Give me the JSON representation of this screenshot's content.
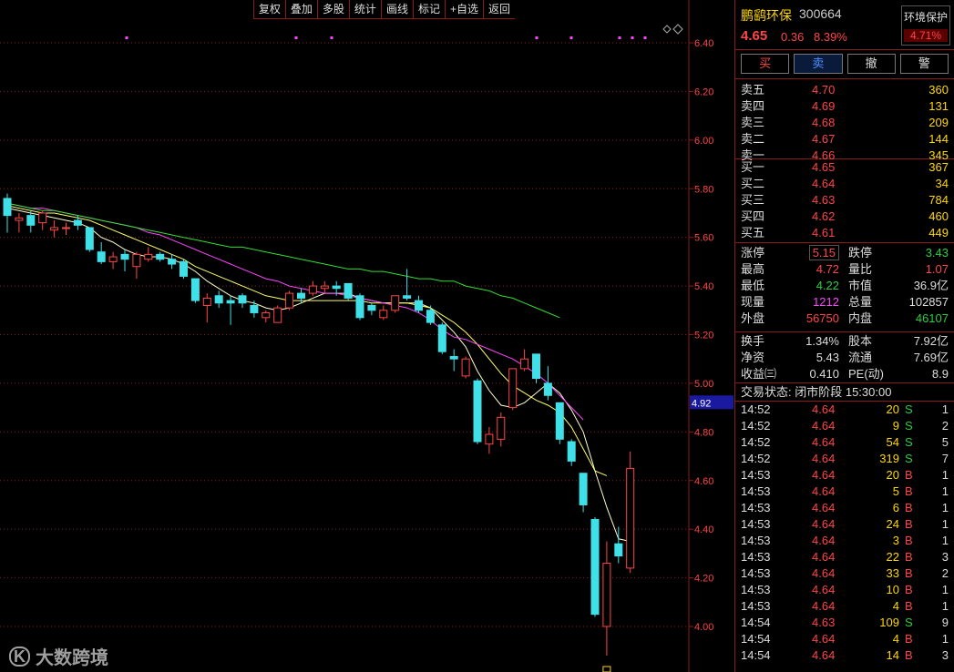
{
  "toolbar": {
    "items": [
      "复权",
      "叠加",
      "多股",
      "统计",
      "画线",
      "标记",
      "+自选",
      "返回"
    ]
  },
  "header": {
    "name": "鹏鹞环保",
    "code": "300664",
    "price": "4.65",
    "change": "0.36",
    "change_pct": "8.39%",
    "sector_name": "环境保护",
    "sector_pct": "4.71%"
  },
  "trade_buttons": {
    "buy": "买",
    "sell": "卖",
    "cancel": "撤",
    "alert": "警"
  },
  "asks": [
    {
      "label": "卖五",
      "price": "4.70",
      "vol": "360"
    },
    {
      "label": "卖四",
      "price": "4.69",
      "vol": "131"
    },
    {
      "label": "卖三",
      "price": "4.68",
      "vol": "209"
    },
    {
      "label": "卖二",
      "price": "4.67",
      "vol": "144"
    },
    {
      "label": "卖一",
      "price": "4.66",
      "vol": "345"
    }
  ],
  "bids": [
    {
      "label": "买一",
      "price": "4.65",
      "vol": "367"
    },
    {
      "label": "买二",
      "price": "4.64",
      "vol": "34"
    },
    {
      "label": "买三",
      "price": "4.63",
      "vol": "784"
    },
    {
      "label": "买四",
      "price": "4.62",
      "vol": "460"
    },
    {
      "label": "买五",
      "price": "4.61",
      "vol": "449"
    }
  ],
  "stats": {
    "limit_up_label": "涨停",
    "limit_up": "5.15",
    "limit_down_label": "跌停",
    "limit_down": "3.43",
    "high_label": "最高",
    "high": "4.72",
    "vol_ratio_label": "量比",
    "vol_ratio": "1.07",
    "low_label": "最低",
    "low": "4.22",
    "mcap_label": "市值",
    "mcap": "36.9亿",
    "last_vol_label": "现量",
    "last_vol": "1212",
    "total_vol_label": "总量",
    "total_vol": "102857",
    "outer_label": "外盘",
    "outer": "56750",
    "inner_label": "内盘",
    "inner": "46107"
  },
  "stats2": {
    "turnover_label": "换手",
    "turnover": "1.34%",
    "shares_label": "股本",
    "shares": "7.92亿",
    "nav_label": "净资",
    "nav": "5.43",
    "float_label": "流通",
    "float": "7.69亿",
    "eps_label": "收益㈢",
    "eps": "0.410",
    "pe_label": "PE(动)",
    "pe": "8.9"
  },
  "status": "交易状态: 闭市阶段 15:30:00",
  "ticks": [
    {
      "time": "14:52",
      "price": "4.64",
      "vol": "20",
      "side": "S",
      "cnt": "1"
    },
    {
      "time": "14:52",
      "price": "4.64",
      "vol": "9",
      "side": "S",
      "cnt": "2"
    },
    {
      "time": "14:52",
      "price": "4.64",
      "vol": "54",
      "side": "S",
      "cnt": "5"
    },
    {
      "time": "14:52",
      "price": "4.64",
      "vol": "319",
      "side": "S",
      "cnt": "7"
    },
    {
      "time": "14:53",
      "price": "4.64",
      "vol": "20",
      "side": "B",
      "cnt": "1"
    },
    {
      "time": "14:53",
      "price": "4.64",
      "vol": "5",
      "side": "B",
      "cnt": "1"
    },
    {
      "time": "14:53",
      "price": "4.64",
      "vol": "6",
      "side": "B",
      "cnt": "1"
    },
    {
      "time": "14:53",
      "price": "4.64",
      "vol": "24",
      "side": "B",
      "cnt": "1"
    },
    {
      "time": "14:53",
      "price": "4.64",
      "vol": "3",
      "side": "B",
      "cnt": "1"
    },
    {
      "time": "14:53",
      "price": "4.64",
      "vol": "22",
      "side": "B",
      "cnt": "3"
    },
    {
      "time": "14:53",
      "price": "4.64",
      "vol": "33",
      "side": "B",
      "cnt": "2"
    },
    {
      "time": "14:53",
      "price": "4.64",
      "vol": "10",
      "side": "B",
      "cnt": "1"
    },
    {
      "time": "14:53",
      "price": "4.64",
      "vol": "4",
      "side": "B",
      "cnt": "1"
    },
    {
      "time": "14:54",
      "price": "4.63",
      "vol": "109",
      "side": "S",
      "cnt": "9"
    },
    {
      "time": "14:54",
      "price": "4.64",
      "vol": "4",
      "side": "B",
      "cnt": "1"
    },
    {
      "time": "14:54",
      "price": "4.64",
      "vol": "14",
      "side": "B",
      "cnt": "3"
    }
  ],
  "watermark": "大数跨境",
  "watermark_logo": "K",
  "colors": {
    "up": "#ff4545",
    "down": "#3fe0e8",
    "ma5": "#ffffcc",
    "ma10": "#ffff66",
    "ma20": "#ff44ff",
    "ma60": "#33dd33",
    "grid": "#8b1a1a",
    "current_price_bg": "#1a1aa0"
  },
  "chart_data": {
    "type": "candlestick",
    "y_ticks": [
      "6.40",
      "6.20",
      "6.00",
      "5.80",
      "5.60",
      "5.40",
      "5.20",
      "5.00",
      "4.80",
      "4.60",
      "4.40",
      "4.20",
      "4.00"
    ],
    "ylim": [
      3.9,
      6.45
    ],
    "current_price_label": "4.92",
    "low_marker_label": "3.88",
    "candles": [
      {
        "o": 5.76,
        "c": 5.69,
        "h": 5.78,
        "l": 5.62
      },
      {
        "o": 5.67,
        "c": 5.68,
        "h": 5.7,
        "l": 5.62
      },
      {
        "o": 5.69,
        "c": 5.65,
        "h": 5.71,
        "l": 5.62
      },
      {
        "o": 5.66,
        "c": 5.7,
        "h": 5.71,
        "l": 5.63
      },
      {
        "o": 5.63,
        "c": 5.64,
        "h": 5.67,
        "l": 5.6
      },
      {
        "o": 5.64,
        "c": 5.64,
        "h": 5.66,
        "l": 5.61
      },
      {
        "o": 5.67,
        "c": 5.65,
        "h": 5.69,
        "l": 5.63
      },
      {
        "o": 5.64,
        "c": 5.55,
        "h": 5.64,
        "l": 5.54
      },
      {
        "o": 5.54,
        "c": 5.5,
        "h": 5.58,
        "l": 5.49
      },
      {
        "o": 5.5,
        "c": 5.52,
        "h": 5.54,
        "l": 5.47
      },
      {
        "o": 5.53,
        "c": 5.51,
        "h": 5.55,
        "l": 5.46
      },
      {
        "o": 5.48,
        "c": 5.53,
        "h": 5.54,
        "l": 5.43
      },
      {
        "o": 5.51,
        "c": 5.53,
        "h": 5.56,
        "l": 5.5
      },
      {
        "o": 5.53,
        "c": 5.51,
        "h": 5.54,
        "l": 5.5
      },
      {
        "o": 5.51,
        "c": 5.49,
        "h": 5.53,
        "l": 5.47
      },
      {
        "o": 5.5,
        "c": 5.44,
        "h": 5.51,
        "l": 5.43
      },
      {
        "o": 5.43,
        "c": 5.34,
        "h": 5.43,
        "l": 5.33
      },
      {
        "o": 5.32,
        "c": 5.35,
        "h": 5.37,
        "l": 5.25
      },
      {
        "o": 5.36,
        "c": 5.33,
        "h": 5.38,
        "l": 5.31
      },
      {
        "o": 5.34,
        "c": 5.33,
        "h": 5.36,
        "l": 5.24
      },
      {
        "o": 5.36,
        "c": 5.33,
        "h": 5.37,
        "l": 5.31
      },
      {
        "o": 5.32,
        "c": 5.29,
        "h": 5.34,
        "l": 5.27
      },
      {
        "o": 5.27,
        "c": 5.29,
        "h": 5.3,
        "l": 5.25
      },
      {
        "o": 5.25,
        "c": 5.31,
        "h": 5.32,
        "l": 5.25
      },
      {
        "o": 5.31,
        "c": 5.37,
        "h": 5.38,
        "l": 5.3
      },
      {
        "o": 5.37,
        "c": 5.35,
        "h": 5.39,
        "l": 5.33
      },
      {
        "o": 5.37,
        "c": 5.4,
        "h": 5.42,
        "l": 5.36
      },
      {
        "o": 5.39,
        "c": 5.4,
        "h": 5.42,
        "l": 5.37
      },
      {
        "o": 5.4,
        "c": 5.39,
        "h": 5.42,
        "l": 5.36
      },
      {
        "o": 5.41,
        "c": 5.35,
        "h": 5.41,
        "l": 5.34
      },
      {
        "o": 5.36,
        "c": 5.27,
        "h": 5.37,
        "l": 5.26
      },
      {
        "o": 5.32,
        "c": 5.3,
        "h": 5.33,
        "l": 5.28
      },
      {
        "o": 5.27,
        "c": 5.3,
        "h": 5.32,
        "l": 5.26
      },
      {
        "o": 5.3,
        "c": 5.36,
        "h": 5.36,
        "l": 5.29
      },
      {
        "o": 5.36,
        "c": 5.35,
        "h": 5.47,
        "l": 5.34
      },
      {
        "o": 5.34,
        "c": 5.3,
        "h": 5.36,
        "l": 5.29
      },
      {
        "o": 5.3,
        "c": 5.25,
        "h": 5.32,
        "l": 5.24
      },
      {
        "o": 5.24,
        "c": 5.13,
        "h": 5.25,
        "l": 5.12
      },
      {
        "o": 5.11,
        "c": 5.1,
        "h": 5.14,
        "l": 5.05
      },
      {
        "o": 5.03,
        "c": 5.1,
        "h": 5.11,
        "l": 5.02
      },
      {
        "o": 5.01,
        "c": 4.76,
        "h": 5.02,
        "l": 4.75
      },
      {
        "o": 4.75,
        "c": 4.79,
        "h": 4.82,
        "l": 4.71
      },
      {
        "o": 4.77,
        "c": 4.86,
        "h": 4.88,
        "l": 4.74
      },
      {
        "o": 4.9,
        "c": 5.06,
        "h": 5.06,
        "l": 4.89
      },
      {
        "o": 5.06,
        "c": 5.1,
        "h": 5.14,
        "l": 5.05
      },
      {
        "o": 5.12,
        "c": 5.02,
        "h": 5.12,
        "l": 5.0
      },
      {
        "o": 5.0,
        "c": 4.95,
        "h": 5.07,
        "l": 4.93
      },
      {
        "o": 4.92,
        "c": 4.77,
        "h": 4.92,
        "l": 4.75
      },
      {
        "o": 4.76,
        "c": 4.68,
        "h": 4.77,
        "l": 4.66
      },
      {
        "o": 4.63,
        "c": 4.5,
        "h": 4.63,
        "l": 4.47
      },
      {
        "o": 4.44,
        "c": 4.05,
        "h": 4.45,
        "l": 4.04
      },
      {
        "o": 4.0,
        "c": 4.26,
        "h": 4.35,
        "l": 3.88
      },
      {
        "o": 4.34,
        "c": 4.29,
        "h": 4.41,
        "l": 4.26
      },
      {
        "o": 4.24,
        "c": 4.65,
        "h": 4.72,
        "l": 4.22
      }
    ],
    "ma_lines": [
      {
        "name": "ma5",
        "values": [
          5.72,
          5.71,
          5.7,
          5.69,
          5.68,
          5.67,
          5.66,
          5.64,
          5.6,
          5.58,
          5.55,
          5.53,
          5.52,
          5.52,
          5.51,
          5.49,
          5.46,
          5.42,
          5.39,
          5.36,
          5.34,
          5.33,
          5.31,
          5.3,
          5.31,
          5.33,
          5.35,
          5.37,
          5.37,
          5.37,
          5.35,
          5.34,
          5.33,
          5.33,
          5.33,
          5.33,
          5.31,
          5.26,
          5.21,
          5.15,
          5.05,
          4.97,
          4.91,
          4.9,
          4.92,
          4.96,
          5.0,
          4.96,
          4.89,
          4.8,
          4.64,
          4.49,
          4.36,
          4.35
        ]
      },
      {
        "name": "ma10",
        "values": [
          5.73,
          5.72,
          5.71,
          5.7,
          5.7,
          5.69,
          5.68,
          5.67,
          5.65,
          5.63,
          5.61,
          5.59,
          5.57,
          5.55,
          5.53,
          5.51,
          5.48,
          5.46,
          5.44,
          5.42,
          5.4,
          5.38,
          5.36,
          5.35,
          5.34,
          5.34,
          5.34,
          5.34,
          5.34,
          5.34,
          5.34,
          5.33,
          5.33,
          5.33,
          5.33,
          5.32,
          5.31,
          5.28,
          5.25,
          5.21,
          5.16,
          5.1,
          5.04,
          4.99,
          4.96,
          4.93,
          4.91,
          4.88,
          4.82,
          4.73,
          4.64,
          4.62
        ]
      },
      {
        "name": "ma20",
        "values": [
          5.74,
          5.73,
          5.72,
          5.72,
          5.71,
          5.7,
          5.69,
          5.68,
          5.67,
          5.66,
          5.65,
          5.64,
          5.62,
          5.61,
          5.59,
          5.57,
          5.55,
          5.53,
          5.51,
          5.49,
          5.47,
          5.45,
          5.43,
          5.42,
          5.4,
          5.39,
          5.38,
          5.37,
          5.37,
          5.36,
          5.35,
          5.34,
          5.33,
          5.32,
          5.31,
          5.29,
          5.26,
          5.22,
          5.19,
          5.18,
          5.16,
          5.14,
          5.12,
          5.1,
          5.07,
          5.04,
          5.0,
          4.95,
          4.9,
          4.85
        ]
      },
      {
        "name": "ma60",
        "values": [
          5.74,
          5.73,
          5.72,
          5.71,
          5.71,
          5.7,
          5.69,
          5.68,
          5.67,
          5.66,
          5.65,
          5.64,
          5.63,
          5.62,
          5.61,
          5.6,
          5.59,
          5.58,
          5.57,
          5.56,
          5.56,
          5.55,
          5.54,
          5.53,
          5.52,
          5.51,
          5.5,
          5.49,
          5.48,
          5.47,
          5.47,
          5.46,
          5.46,
          5.45,
          5.44,
          5.43,
          5.43,
          5.42,
          5.42,
          5.4,
          5.39,
          5.38,
          5.36,
          5.35,
          5.33,
          5.31,
          5.29,
          5.27
        ]
      }
    ],
    "markers_count": 9
  }
}
